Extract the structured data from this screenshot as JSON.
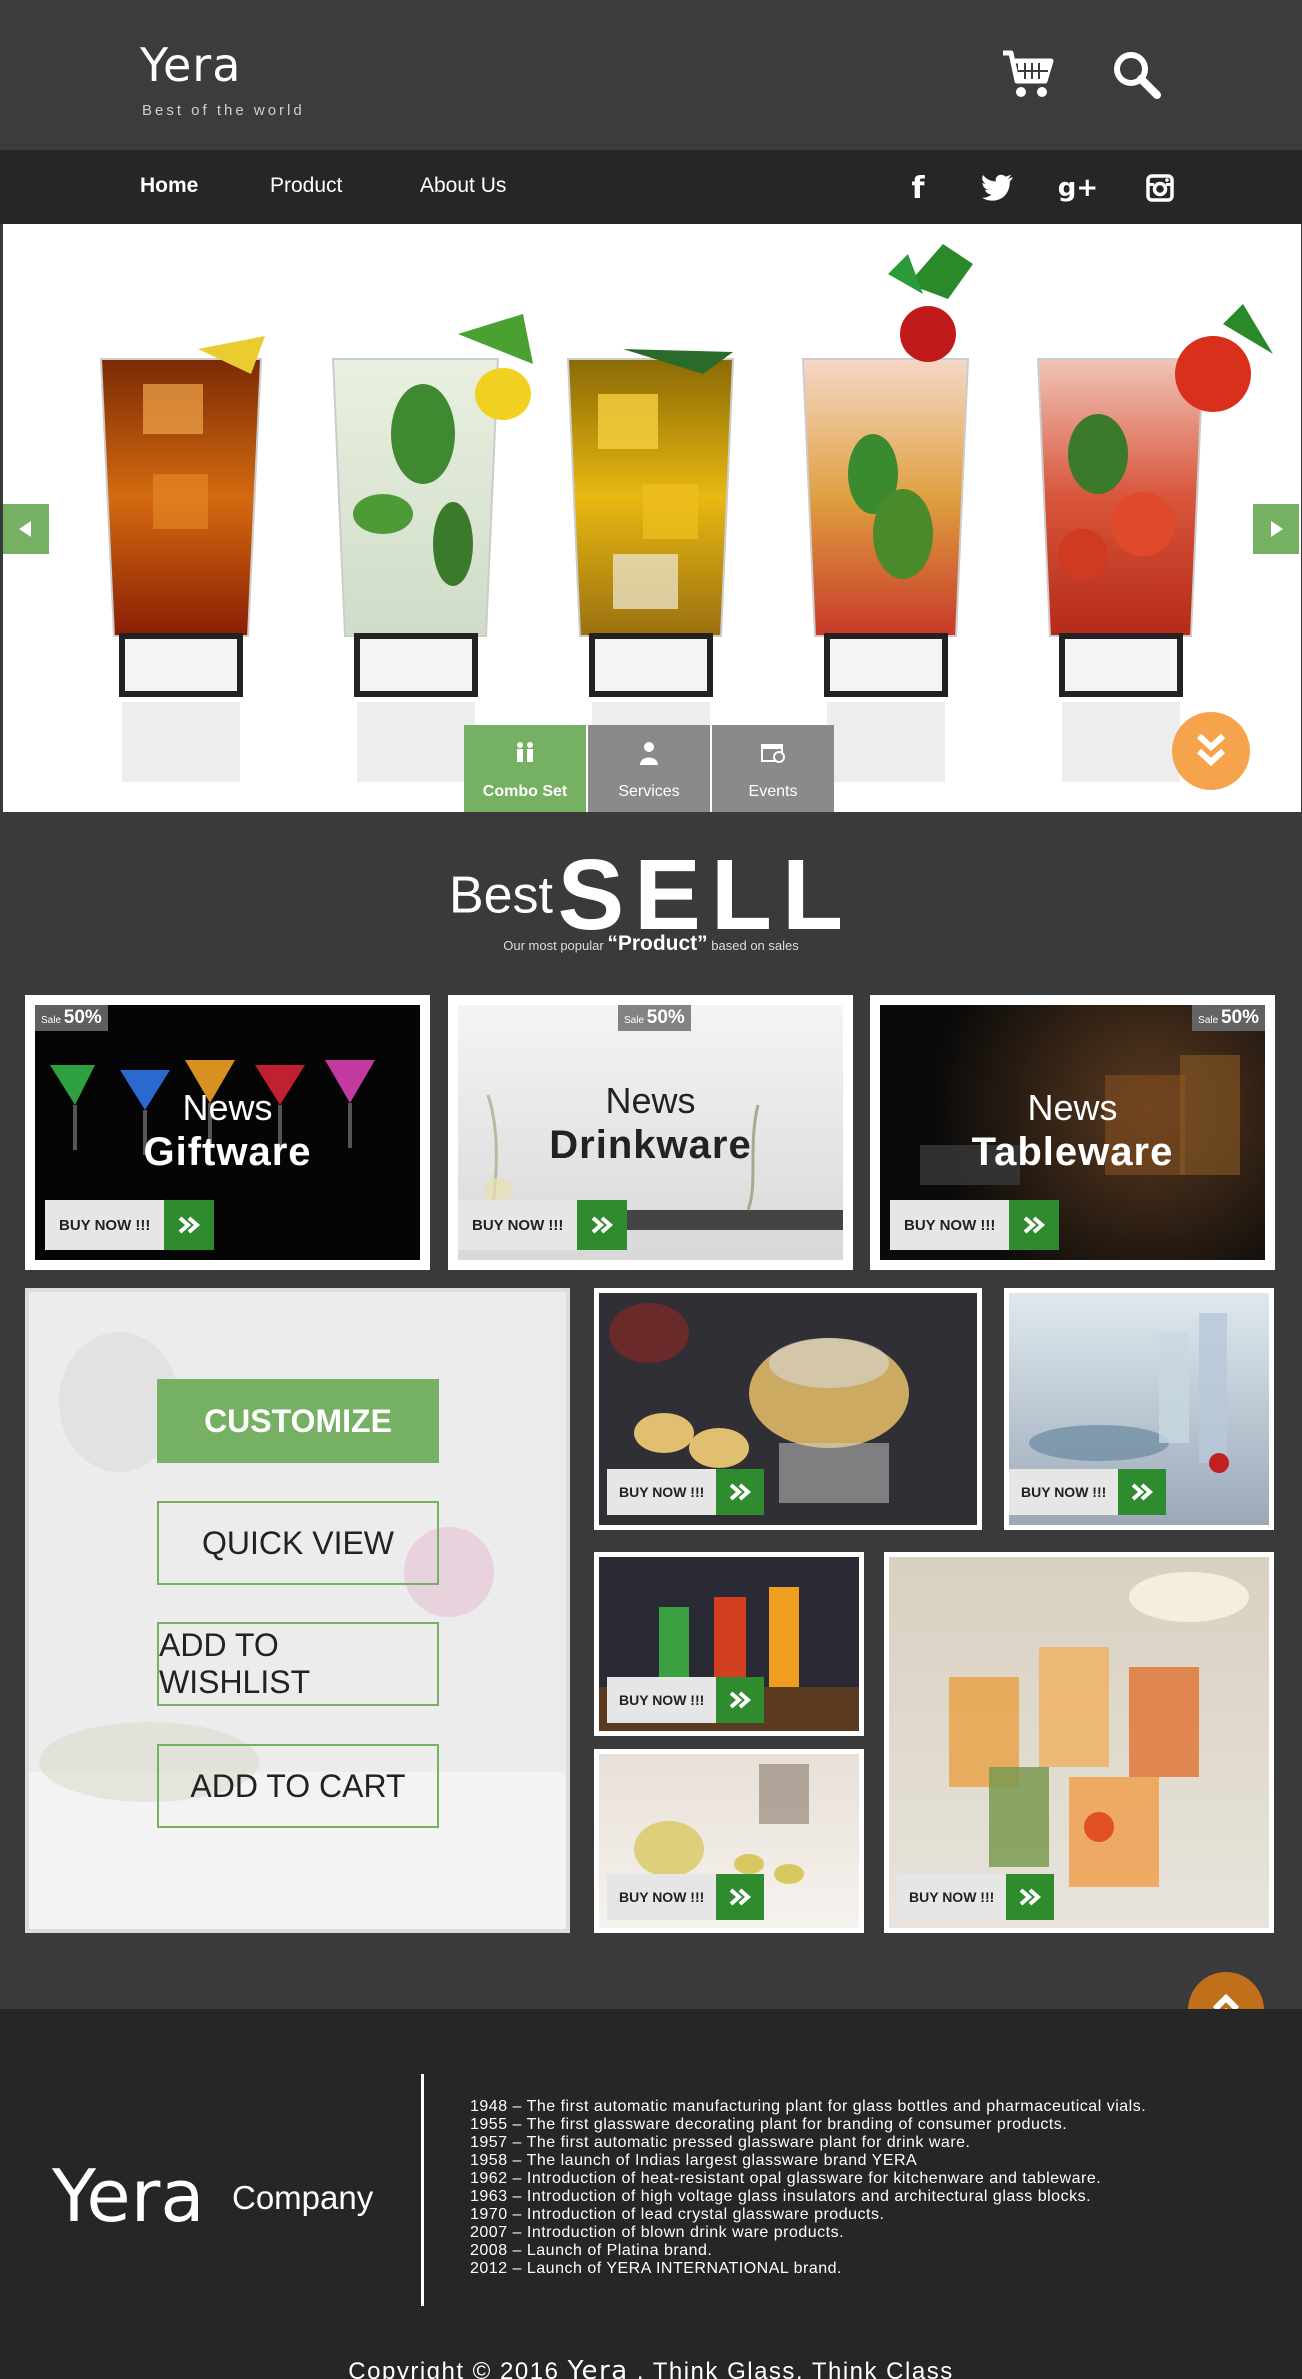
{
  "header": {
    "logo_text": "Yera",
    "tagline": "Best of the world"
  },
  "nav": {
    "items": [
      {
        "label": "Home",
        "active": true
      },
      {
        "label": "Product",
        "active": false
      },
      {
        "label": "About Us",
        "active": false
      }
    ],
    "social_icons": [
      "facebook-icon",
      "twitter-icon",
      "google-plus-icon",
      "instagram-icon"
    ],
    "google_plus_glyph": "g+"
  },
  "hero": {
    "tabs": [
      {
        "label": "Combo Set",
        "icon": "people-icon",
        "active": true
      },
      {
        "label": "Services",
        "icon": "waiter-icon",
        "active": false
      },
      {
        "label": "Events",
        "icon": "calendar-icon",
        "active": false
      }
    ]
  },
  "best_sell": {
    "best": "Best",
    "sell": "SELL",
    "sub_prefix": "Our most popular",
    "sub_bold": "“Product”",
    "sub_suffix": "based on sales"
  },
  "featured": [
    {
      "news": "News",
      "category": "Giftware",
      "sale_prefix": "Sale",
      "sale_pct": "50%",
      "buy": "BUY NOW !!!"
    },
    {
      "news": "News",
      "category": "Drinkware",
      "sale_prefix": "Sale",
      "sale_pct": "50%",
      "buy": "BUY NOW !!!"
    },
    {
      "news": "News",
      "category": "Tableware",
      "sale_prefix": "Sale",
      "sale_pct": "50%",
      "buy": "BUY NOW !!!"
    }
  ],
  "customize": {
    "customize": "CUSTOMIZE",
    "quick_view": "QUICK VIEW",
    "add_to_wishlist": "ADD TO WISHLIST",
    "add_to_cart": "ADD TO CART"
  },
  "grid_buy_label": "BUY NOW !!!",
  "footer": {
    "logo_text": "Yera",
    "company": "Company",
    "timeline": [
      "1948 –  The first automatic manufacturing plant for glass bottles and pharmaceutical vials.",
      "1955 – The first glassware decorating plant for branding of consumer products.",
      "1957 – The first automatic pressed glassware plant for drink ware.",
      "1958 – The launch of Indias largest glassware brand YERA",
      "1962 – Introduction of heat-resistant opal glassware for kitchenware and tableware.",
      "1963 – Introduction of high voltage glass insulators and architectural glass blocks.",
      "1970 – Introduction of lead crystal glassware products.",
      "2007 – Introduction of blown drink ware products.",
      "2008 – Launch of Platina brand.",
      "2012 – Launch of YERA INTERNATIONAL brand."
    ],
    "copyright_prefix": "Copyright © 2016",
    "copyright_logo": "Yera",
    "copyright_suffix": ". Think Glass. Think Class"
  },
  "colors": {
    "accent_green": "#76b062",
    "buy_arrow_green": "#2e8b2e",
    "scroll_orange": "#f6a44c",
    "to_top_orange": "#c0701a"
  }
}
